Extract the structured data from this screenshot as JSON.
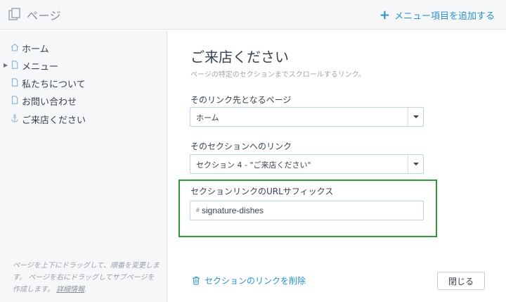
{
  "header": {
    "title": "ページ",
    "add_menu_item": "メニュー項目を追加する",
    "pages_icon": "pages-icon",
    "plus_icon": "plus-icon"
  },
  "sidebar": {
    "items": [
      {
        "label": "ホーム",
        "icon": "home-icon",
        "expandable": false
      },
      {
        "label": "メニュー",
        "icon": "page-icon",
        "expandable": true
      },
      {
        "label": "私たちについて",
        "icon": "page-icon",
        "expandable": false
      },
      {
        "label": "お問い合わせ",
        "icon": "page-icon",
        "expandable": false
      },
      {
        "label": "ご来店ください",
        "icon": "anchor-icon",
        "expandable": false
      }
    ],
    "hint_text": "ページを上下にドラッグして、順番を変更します。 ページを右にドラッグしてサブページを作成します。",
    "hint_link": "詳細情報",
    "hint_end": "."
  },
  "main": {
    "title": "ご来店ください",
    "subtitle": "ページの特定のセクションまでスクロールするリンク。",
    "page_select": {
      "label": "そのリンク先となるページ",
      "value": "ホーム"
    },
    "section_select": {
      "label": "そのセクションへのリンク",
      "value": "セクション 4 - \"ご来店ください\""
    },
    "url_suffix": {
      "label": "セクションリンクのURLサフィックス",
      "prefix": "#",
      "value": "signature-dishes"
    },
    "delete_link": "セクションのリンクを削除",
    "close_button": "閉じる"
  },
  "colors": {
    "accent": "#2a92d0",
    "highlight": "#2c9a3a",
    "sidebar_bg": "#f6f7f8"
  }
}
